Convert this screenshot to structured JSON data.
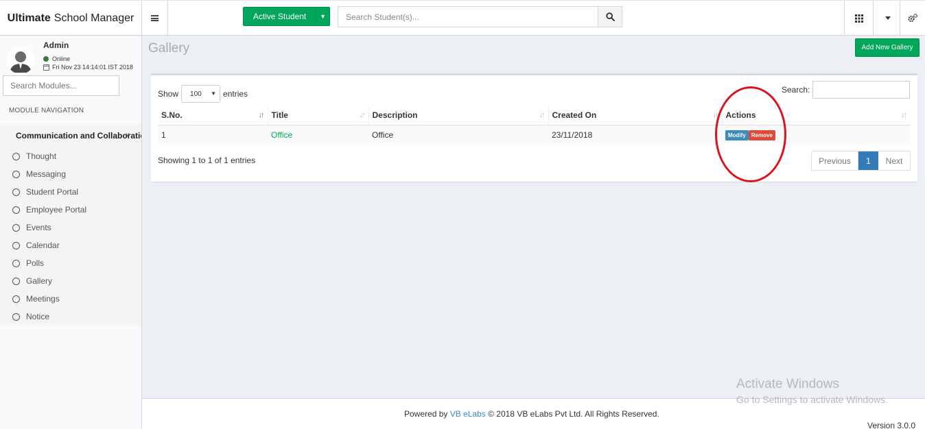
{
  "header": {
    "brand_bold": "Ultimate",
    "brand_rest": "School Manager",
    "active_student_label": "Active Student",
    "search_placeholder": "Search Student(s)..."
  },
  "sidebar": {
    "user_name": "Admin",
    "status": "Online",
    "datetime": "Fri Nov 23 14:14:01 IST 2018",
    "search_placeholder": "Search Modules...",
    "nav_heading": "MODULE NAVIGATION",
    "module_label": "Communication and Collaboration",
    "items": [
      "Thought",
      "Messaging",
      "Student Portal",
      "Employee Portal",
      "Events",
      "Calendar",
      "Polls",
      "Gallery",
      "Meetings",
      "Notice"
    ]
  },
  "page": {
    "title": "Gallery",
    "add_button": "Add New Gallery"
  },
  "table_controls": {
    "show_label": "Show",
    "page_size": "100",
    "entries_label": "entries",
    "search_label": "Search:"
  },
  "table": {
    "headers": [
      "S.No.",
      "Title",
      "Description",
      "Created On",
      "Actions"
    ],
    "rows": [
      {
        "sno": "1",
        "title": "Office",
        "description": "Office",
        "created_on": "23/11/2018"
      }
    ],
    "modify_label": "Modify",
    "remove_label": "Remove"
  },
  "pagination": {
    "info": "Showing 1 to 1 of 1 entries",
    "previous": "Previous",
    "current": "1",
    "next": "Next"
  },
  "footer": {
    "powered_by": "Powered by",
    "company_link": "VB eLabs",
    "copyright": "© 2018 VB eLabs Pvt Ltd. All Rights Reserved.",
    "version": "Version 3.0.0"
  },
  "watermark": {
    "line1": "Activate Windows",
    "line2": "Go to Settings to activate Windows."
  },
  "colors": {
    "brand_green": "#00a65a",
    "primary_blue": "#3c8dbc",
    "danger_red": "#dd4b39",
    "annotation_red": "#d9141c"
  }
}
